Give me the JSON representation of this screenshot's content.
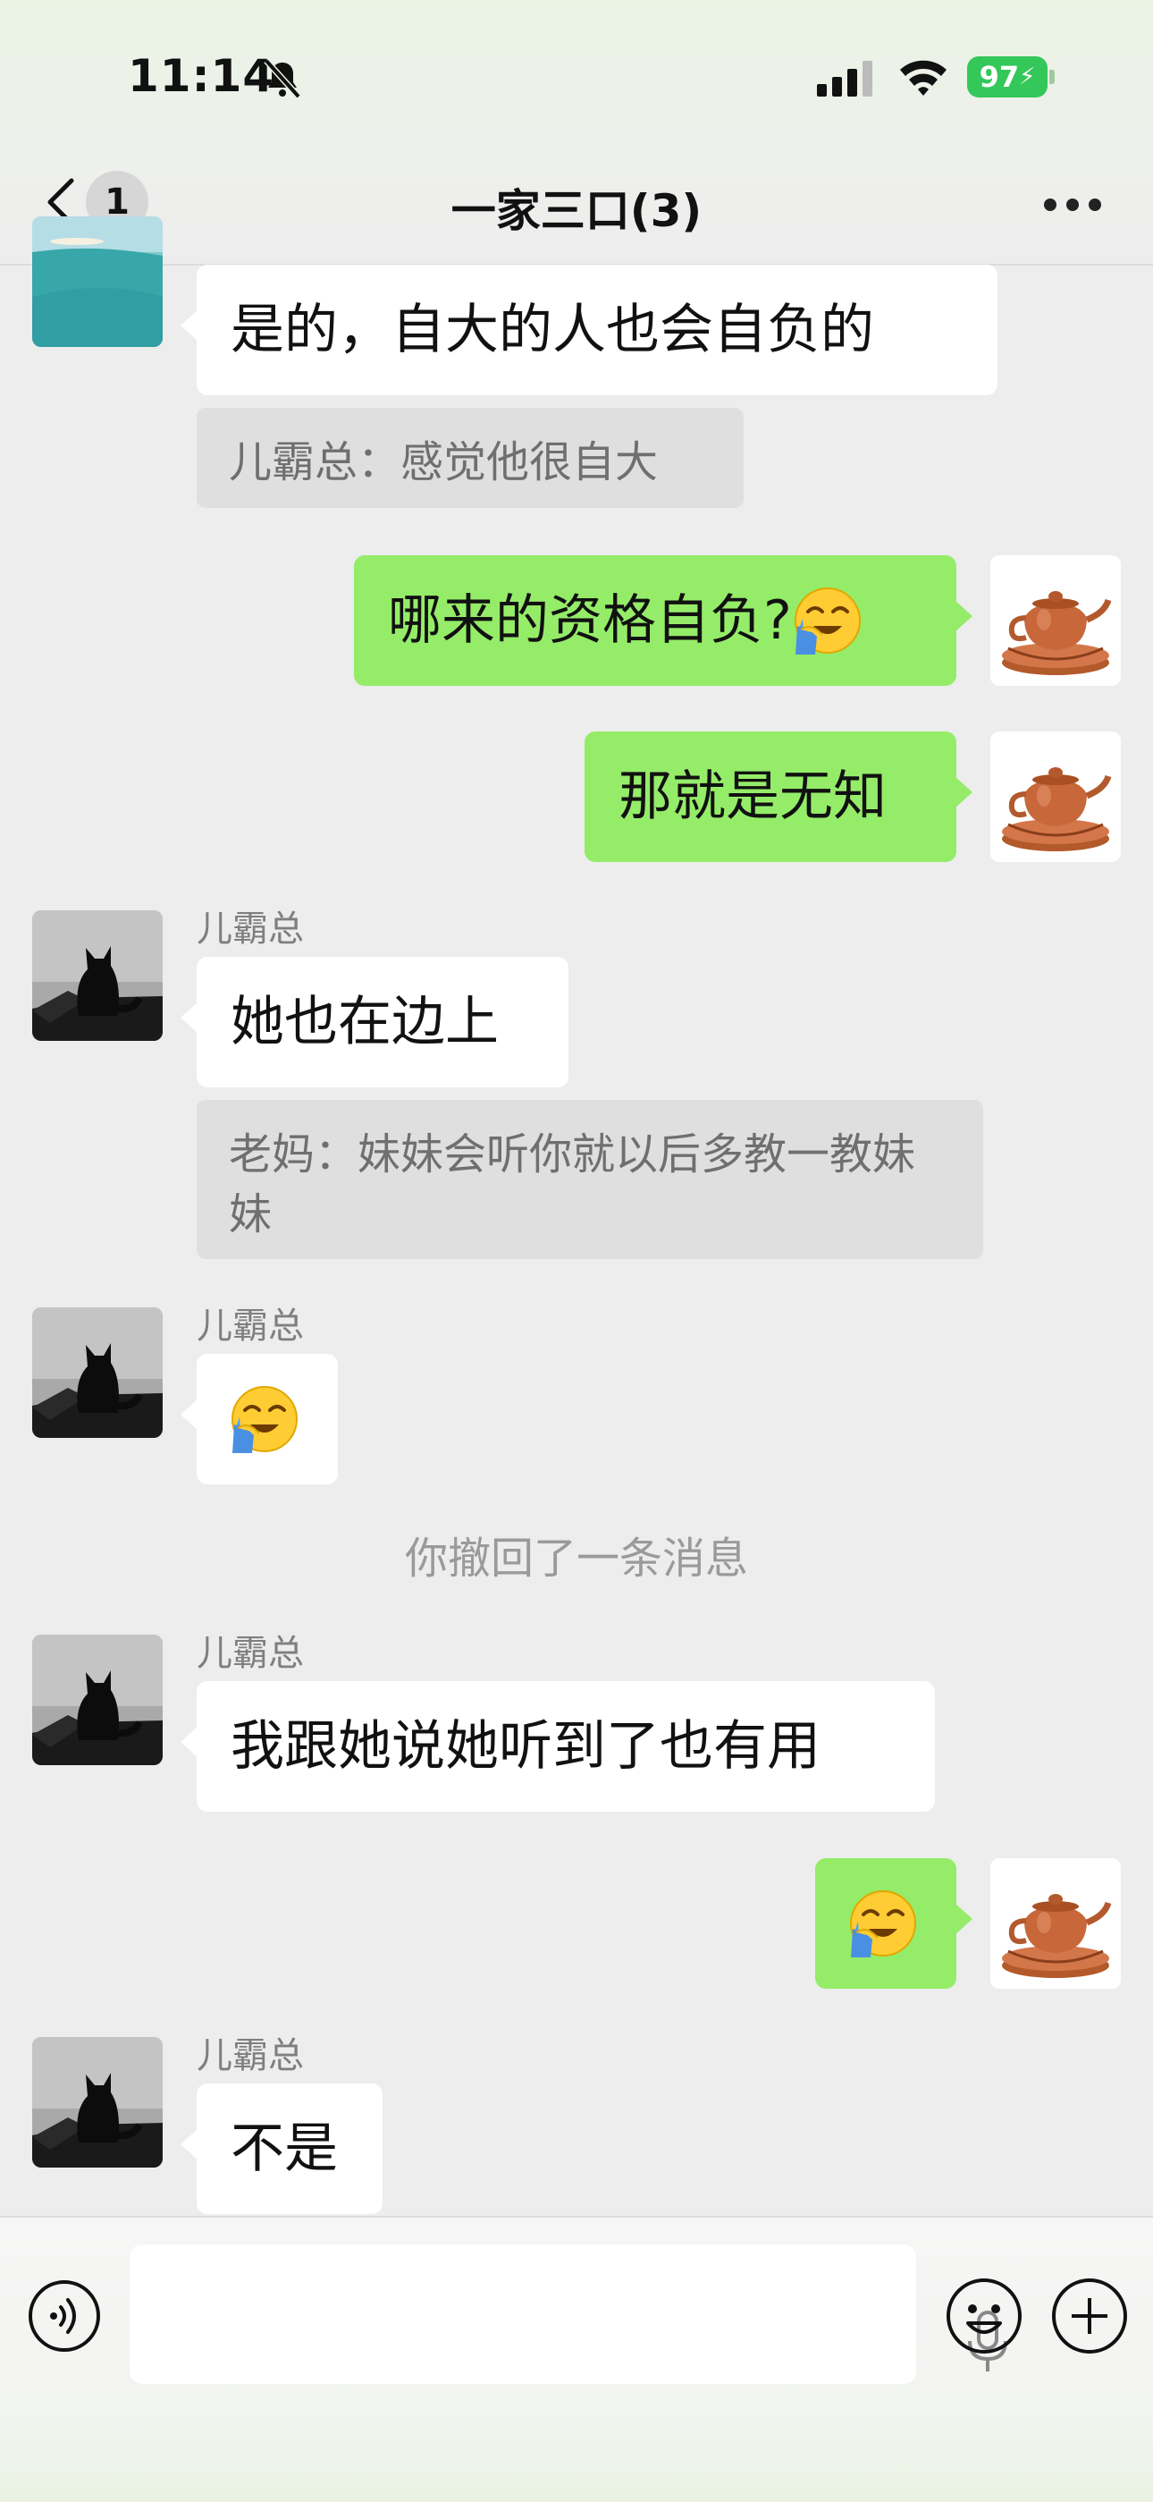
{
  "status_bar": {
    "time": "11:14",
    "battery": "97"
  },
  "header": {
    "back_badge": "1",
    "title": "一家三口(3)"
  },
  "messages": {
    "m1_text": "是的，自大的人也会自负的",
    "m1_quote": "儿霸总：感觉他很自大",
    "m2_text": "哪来的资格自负?",
    "m3_text": "那就是无知",
    "m4_sender": "儿霸总",
    "m4_text": "她也在边上",
    "m4_quote": "老妈：妹妹会听你就以后多教一教妹妹",
    "m5_sender": "儿霸总",
    "recall_notice": "你撤回了一条消息",
    "m6_sender": "儿霸总",
    "m6_text": "我跟她说她听到了也有用",
    "m8_sender": "儿霸总",
    "m8_text": "不是"
  },
  "icons": {
    "emoji": "facepalm-crying-emoji",
    "my_avatar": "teapot",
    "other_avatar": "cat-silhouette"
  },
  "colors": {
    "green_bubble": "#95ec69",
    "white_bubble": "#ffffff",
    "background": "#ededed",
    "battery": "#34c759"
  }
}
